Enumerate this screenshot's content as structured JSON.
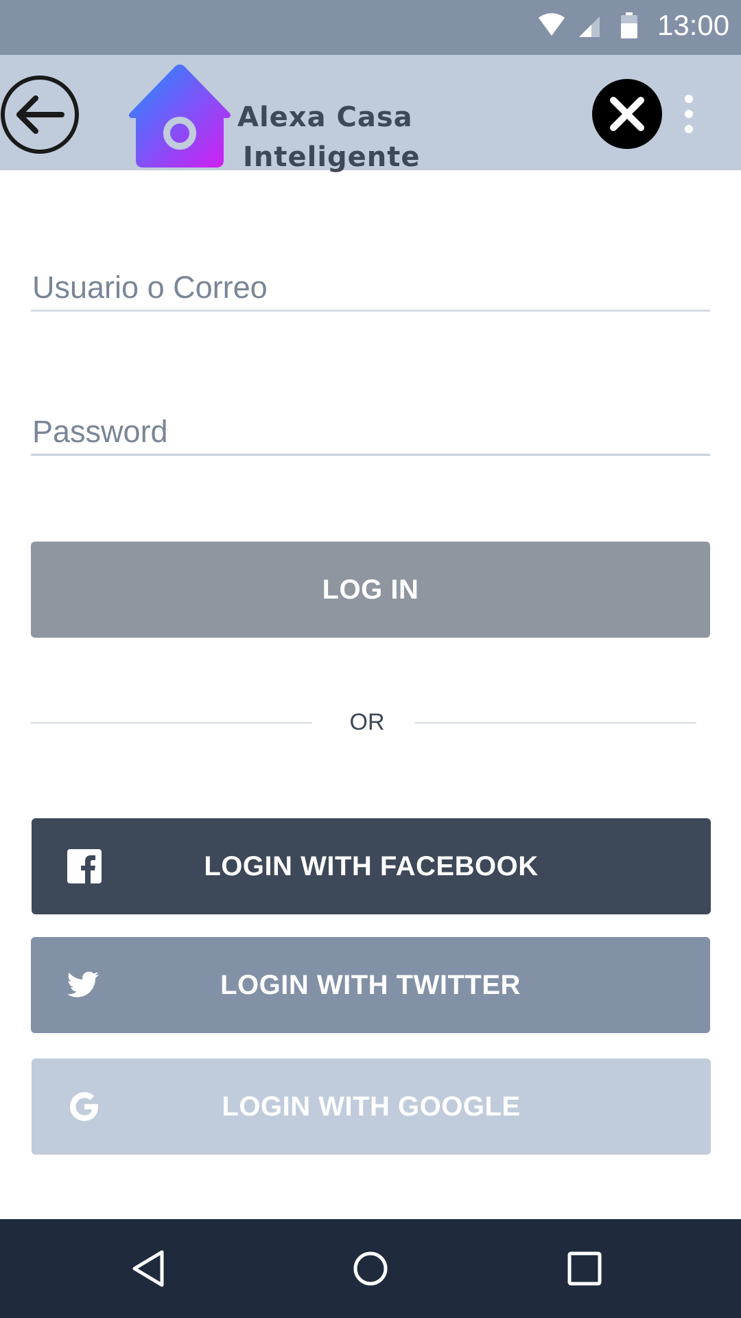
{
  "status_bar": {
    "time": "13:00",
    "icons": [
      "wifi-icon",
      "signal-icon",
      "battery-icon"
    ]
  },
  "app_bar": {
    "title_line1": "Alexa Casa",
    "title_line2": "Inteligente",
    "icons": [
      "back-arrow-icon",
      "home-logo-icon",
      "close-icon",
      "more-vert-icon"
    ]
  },
  "form": {
    "username_placeholder": "Usuario o Correo",
    "password_placeholder": "Password",
    "login_label": "LOG IN",
    "or_label": "OR"
  },
  "social": {
    "facebook_label": "LOGIN WITH FACEBOOK",
    "twitter_label": "LOGIN WITH TWITTER",
    "google_label": "LOGIN WITH GOOGLE"
  },
  "nav_bar": {
    "icons": [
      "nav-back-icon",
      "nav-home-icon",
      "nav-recents-icon"
    ]
  },
  "colors": {
    "status_bar": "#8391a7",
    "app_bar": "#c0ccdb",
    "login_button": "#8f969f",
    "facebook_button": "#3d4859",
    "twitter_button": "#8391a7",
    "google_button": "#c0ccdb",
    "nav_bar": "#1f2b3d",
    "logo_gradient_start": "#1f8fff",
    "logo_gradient_end": "#d61cf0"
  }
}
